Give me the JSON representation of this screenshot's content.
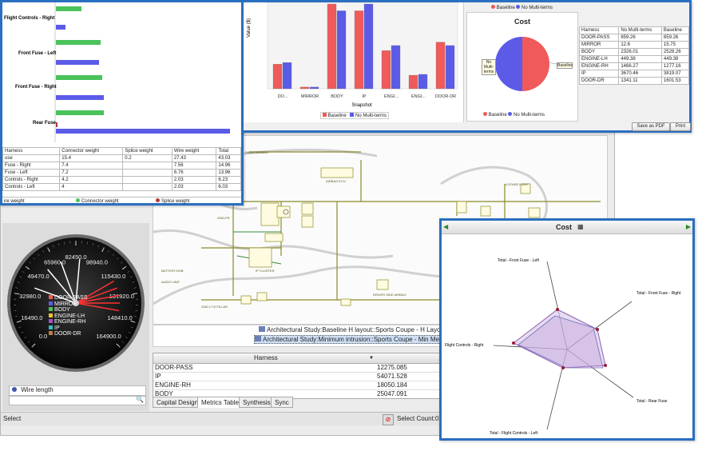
{
  "colors": {
    "baseline": "#f05a5a",
    "nomulti": "#5b5be8",
    "wire": "#49c35a",
    "frame": "#2a6fc0"
  },
  "weight_panel": {
    "bar_labels": [
      "Flight Controls - Right",
      "Front Fuse - Left",
      "Front Fuse - Right",
      "Rear Fuse"
    ],
    "table_headers": [
      "Harness",
      "Connector weight",
      "Splice weight",
      "Wire weight",
      "Total"
    ],
    "table_rows": [
      [
        "use",
        "15.4",
        "0.2",
        "27.43",
        "43.03"
      ],
      [
        "Fuse - Right",
        "7.4",
        "",
        "7.56",
        "14.96"
      ],
      [
        "Fuse - Left",
        "7.2",
        "",
        "6.76",
        "13.96"
      ],
      [
        "Controls - Right",
        "4.2",
        "",
        "2.03",
        "6.23"
      ],
      [
        "Controls - Left",
        "4",
        "",
        "2.03",
        "6.03"
      ]
    ],
    "legend": [
      "ire weight",
      "Connector weight",
      "Splice weight"
    ]
  },
  "snapshot_panel": {
    "ylabel": "Value ($)",
    "xlabel": "Snapshot",
    "legend": [
      "Baseline",
      "No Multi-terms"
    ],
    "pie_title": "Cost",
    "pie_label_left": "No Multi-terms",
    "pie_label_right": "Baseline",
    "table_headers": [
      "Harness",
      "No Multi-terms",
      "Baseline"
    ],
    "table_rows": [
      [
        "DOOR-PASS",
        "859.26",
        "859.26"
      ],
      [
        "MIRROR",
        "12.6",
        "15.75"
      ],
      [
        "BODY",
        "2326.01",
        "2528.26"
      ],
      [
        "ENGINE-LH",
        "449.38",
        "449.38"
      ],
      [
        "ENGINE-RH",
        "1466.27",
        "1277.16"
      ],
      [
        "IP",
        "3670.46",
        "3819.07"
      ],
      [
        "DOOR-DR",
        "1341.11",
        "1601.53"
      ]
    ],
    "save_pdf": "Save as PDF",
    "print": "Print"
  },
  "chart_data": [
    {
      "type": "bar",
      "categories": [
        "DO...",
        "MIRROR",
        "BODY",
        "IP",
        "ENGI...",
        "ENGI...",
        "DOOR-DR"
      ],
      "series": [
        {
          "name": "Baseline",
          "values": [
            0.29,
            0.02,
            1.0,
            0.92,
            0.45,
            0.16,
            0.55
          ]
        },
        {
          "name": "No Multi-terms",
          "values": [
            0.31,
            0.02,
            0.92,
            1.0,
            0.51,
            0.17,
            0.51
          ]
        }
      ],
      "xlabel": "Snapshot",
      "ylabel": "Value ($)"
    },
    {
      "type": "pie",
      "title": "Cost",
      "series": [
        {
          "name": "Baseline",
          "values": [
            0.5
          ]
        },
        {
          "name": "No Multi-terms",
          "values": [
            0.5
          ]
        }
      ]
    }
  ],
  "gauge": {
    "ticks": [
      "0.0",
      "16490.0",
      "32980.0",
      "49470.0",
      "65960.0",
      "82450.0",
      "98940.0",
      "115430.0",
      "131920.0",
      "148410.0",
      "164900.0"
    ],
    "legend": [
      "DOOR-PASS",
      "MIRROR",
      "BODY",
      "ENGINE-LH",
      "ENGINE-RH",
      "IP",
      "DOOR-DR"
    ],
    "radio_label": "Wire length"
  },
  "schematic_labels": [
    "AIRBAG ECU",
    "LICENSE LIGHT",
    "TRUNK LATCH",
    "WINDER",
    "DRIVER SIDE AIRBAG",
    "IP CLUSTER",
    "BATTERY-RHB"
  ],
  "studies": [
    "Architectural Study:Baseline H layout::Sports Coupe - H Layout::",
    "Architectural Study:Minimum intrusion::Sports Coupe - Min Mech L"
  ],
  "harness_table": {
    "header": "Harness",
    "rows": [
      [
        "DOOR-PASS",
        "12275.085"
      ],
      [
        "IP",
        "54071.528"
      ],
      [
        "ENGINE-RH",
        "18050.184"
      ],
      [
        "BODY",
        "25047.091"
      ]
    ]
  },
  "tabs": [
    "Capital Design",
    "Metrics Table",
    "Synthesis",
    "Sync"
  ],
  "status": {
    "left": "Select",
    "right": "Select Count:0"
  },
  "radar": {
    "title": "Cost",
    "axes": [
      "Total - Front Fuse - Left",
      "Total - Front Fuse - Right",
      "Flight Controls - Right",
      "Total - Rear Fuse",
      "Total - Flight Controls - Left"
    ]
  }
}
